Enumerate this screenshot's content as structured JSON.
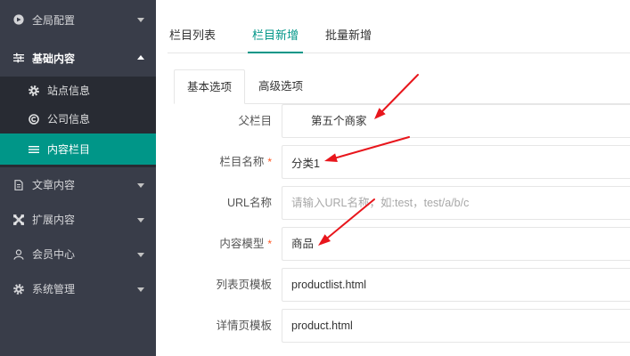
{
  "sidebar": {
    "items": [
      {
        "label": "全局配置",
        "icon": "settings-circle-icon",
        "expanded": false
      },
      {
        "label": "基础内容",
        "icon": "sliders-icon",
        "expanded": true,
        "children": [
          {
            "label": "站点信息",
            "icon": "gear-icon"
          },
          {
            "label": "公司信息",
            "icon": "copyright-icon"
          },
          {
            "label": "内容栏目",
            "icon": "menu-icon",
            "active": true
          }
        ]
      },
      {
        "label": "文章内容",
        "icon": "document-icon",
        "expanded": false
      },
      {
        "label": "扩展内容",
        "icon": "expand-icon",
        "expanded": false
      },
      {
        "label": "会员中心",
        "icon": "user-icon",
        "expanded": false
      },
      {
        "label": "系统管理",
        "icon": "gear-icon",
        "expanded": false
      }
    ]
  },
  "top_tabs": [
    {
      "label": "栏目列表",
      "active": false
    },
    {
      "label": "栏目新增",
      "active": true
    },
    {
      "label": "批量新增",
      "active": false
    }
  ],
  "form_tabs": [
    {
      "label": "基本选项",
      "active": true
    },
    {
      "label": "高级选项",
      "active": false
    }
  ],
  "form": {
    "fields": [
      {
        "label": "父栏目",
        "value": "第五个商家"
      },
      {
        "label": "栏目名称",
        "required_mark": "*",
        "value": "分类1"
      },
      {
        "label": "URL名称",
        "value": "",
        "placeholder": "请输入URL名称，如:test，test/a/b/c"
      },
      {
        "label": "内容模型",
        "required_mark": "*",
        "value": "商品"
      },
      {
        "label": "列表页模板",
        "value": "productlist.html"
      },
      {
        "label": "详情页模板",
        "value": "product.html"
      }
    ]
  },
  "colors": {
    "sidebar_bg": "#393d49",
    "sidebar_active_bg": "#009688",
    "accent": "#009688",
    "required_mark": "#ff5722",
    "annotation_arrow": "#e8161c"
  }
}
